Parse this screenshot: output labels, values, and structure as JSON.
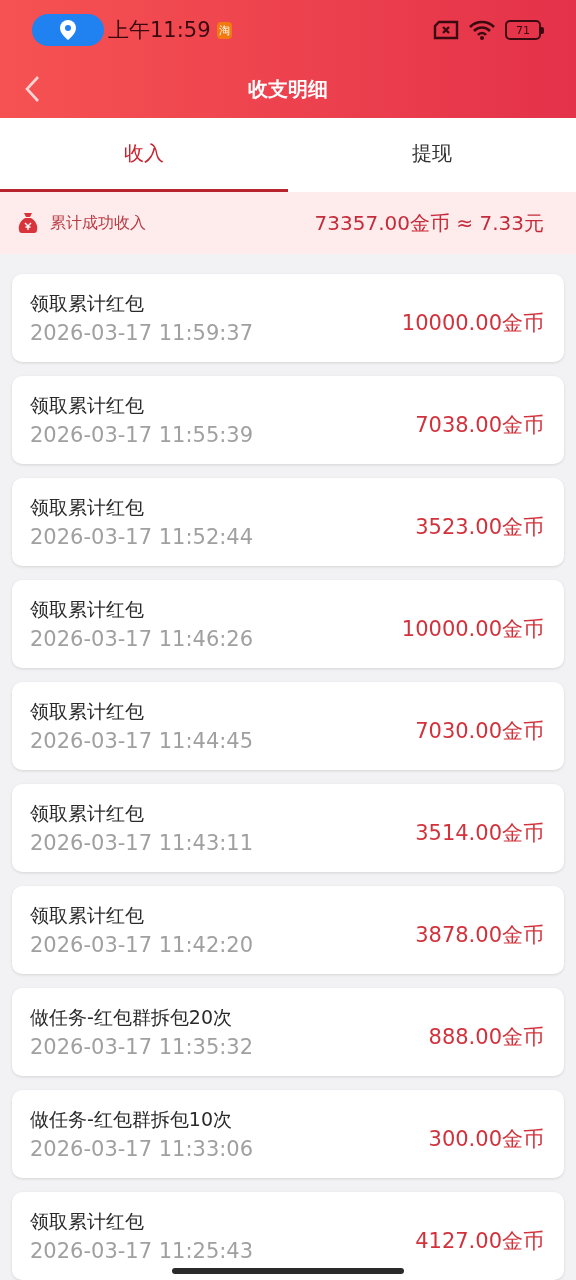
{
  "status_bar": {
    "time": "上午11:59",
    "app_badge": "淘",
    "battery": "71"
  },
  "header": {
    "title": "收支明细"
  },
  "tabs": [
    {
      "label": "收入",
      "selected": true
    },
    {
      "label": "提现",
      "selected": false
    }
  ],
  "summary": {
    "label": "累计成功收入",
    "value": "73357.00金币 ≈ 7.33元"
  },
  "records": [
    {
      "title": "领取累计红包",
      "time": "2026-03-17 11:59:37",
      "amount": "10000.00金币"
    },
    {
      "title": "领取累计红包",
      "time": "2026-03-17 11:55:39",
      "amount": "7038.00金币"
    },
    {
      "title": "领取累计红包",
      "time": "2026-03-17 11:52:44",
      "amount": "3523.00金币"
    },
    {
      "title": "领取累计红包",
      "time": "2026-03-17 11:46:26",
      "amount": "10000.00金币"
    },
    {
      "title": "领取累计红包",
      "time": "2026-03-17 11:44:45",
      "amount": "7030.00金币"
    },
    {
      "title": "领取累计红包",
      "time": "2026-03-17 11:43:11",
      "amount": "3514.00金币"
    },
    {
      "title": "领取累计红包",
      "time": "2026-03-17 11:42:20",
      "amount": "3878.00金币"
    },
    {
      "title": "做任务-红包群拆包20次",
      "time": "2026-03-17 11:35:32",
      "amount": "888.00金币"
    },
    {
      "title": "做任务-红包群拆包10次",
      "time": "2026-03-17 11:33:06",
      "amount": "300.00金币"
    },
    {
      "title": "领取累计红包",
      "time": "2026-03-17 11:25:43",
      "amount": "4127.00金币"
    }
  ]
}
